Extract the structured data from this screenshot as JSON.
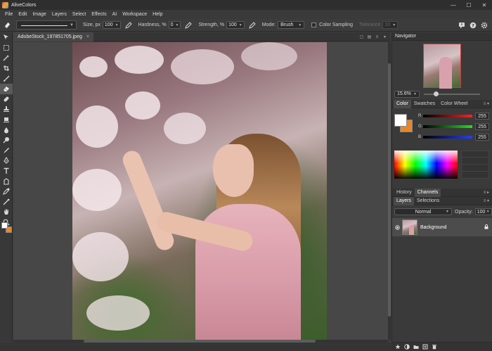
{
  "app": {
    "title": "AliveColors"
  },
  "window_buttons": [
    "—",
    "☐",
    "✕"
  ],
  "menu": [
    "File",
    "Edit",
    "Image",
    "Layers",
    "Select",
    "Effects",
    "AI",
    "Workspace",
    "Help"
  ],
  "options": {
    "size_label": "Size, px",
    "size_value": "100",
    "hardness_label": "Hardness, %",
    "hardness_value": "0",
    "strength_label": "Strength, %",
    "strength_value": "100",
    "mode_label": "Mode:",
    "mode_value": "Brush",
    "color_sampling_label": "Color Sampling",
    "tolerance_label": "Tolerance",
    "tolerance_value": "10"
  },
  "document": {
    "tab_name": "AdobeStock_197851705.jpeg",
    "close_glyph": "×"
  },
  "navigator": {
    "title": "Navigator",
    "zoom": "15.6%",
    "zoom_fraction": 0.22
  },
  "color_panel": {
    "tabs": [
      "Color",
      "Swatches",
      "Color Wheel"
    ],
    "channels": [
      {
        "label": "R",
        "value": "255"
      },
      {
        "label": "G",
        "value": "255"
      },
      {
        "label": "B",
        "value": "255"
      }
    ],
    "foreground": "#ffffff",
    "background": "#e8872a"
  },
  "history_panel": {
    "tabs": [
      "History",
      "Channels"
    ]
  },
  "layers_panel": {
    "tabs": [
      "Layers",
      "Selections"
    ],
    "blend_mode": "Normal",
    "opacity_label": "Opacity:",
    "opacity_value": "100",
    "layers": [
      {
        "name": "Background"
      }
    ]
  },
  "icons": {
    "toolbar": [
      "move-icon",
      "marquee-icon",
      "magic-wand-icon",
      "crop-icon",
      "brush-icon",
      "eraser-icon",
      "healing-icon",
      "stamp-icon",
      "clone-icon",
      "blur-icon",
      "dodge-icon",
      "smudge-icon",
      "pen-icon",
      "text-icon",
      "shape-icon",
      "eyedropper-icon",
      "measure-icon",
      "hand-icon",
      "zoom-icon"
    ]
  }
}
